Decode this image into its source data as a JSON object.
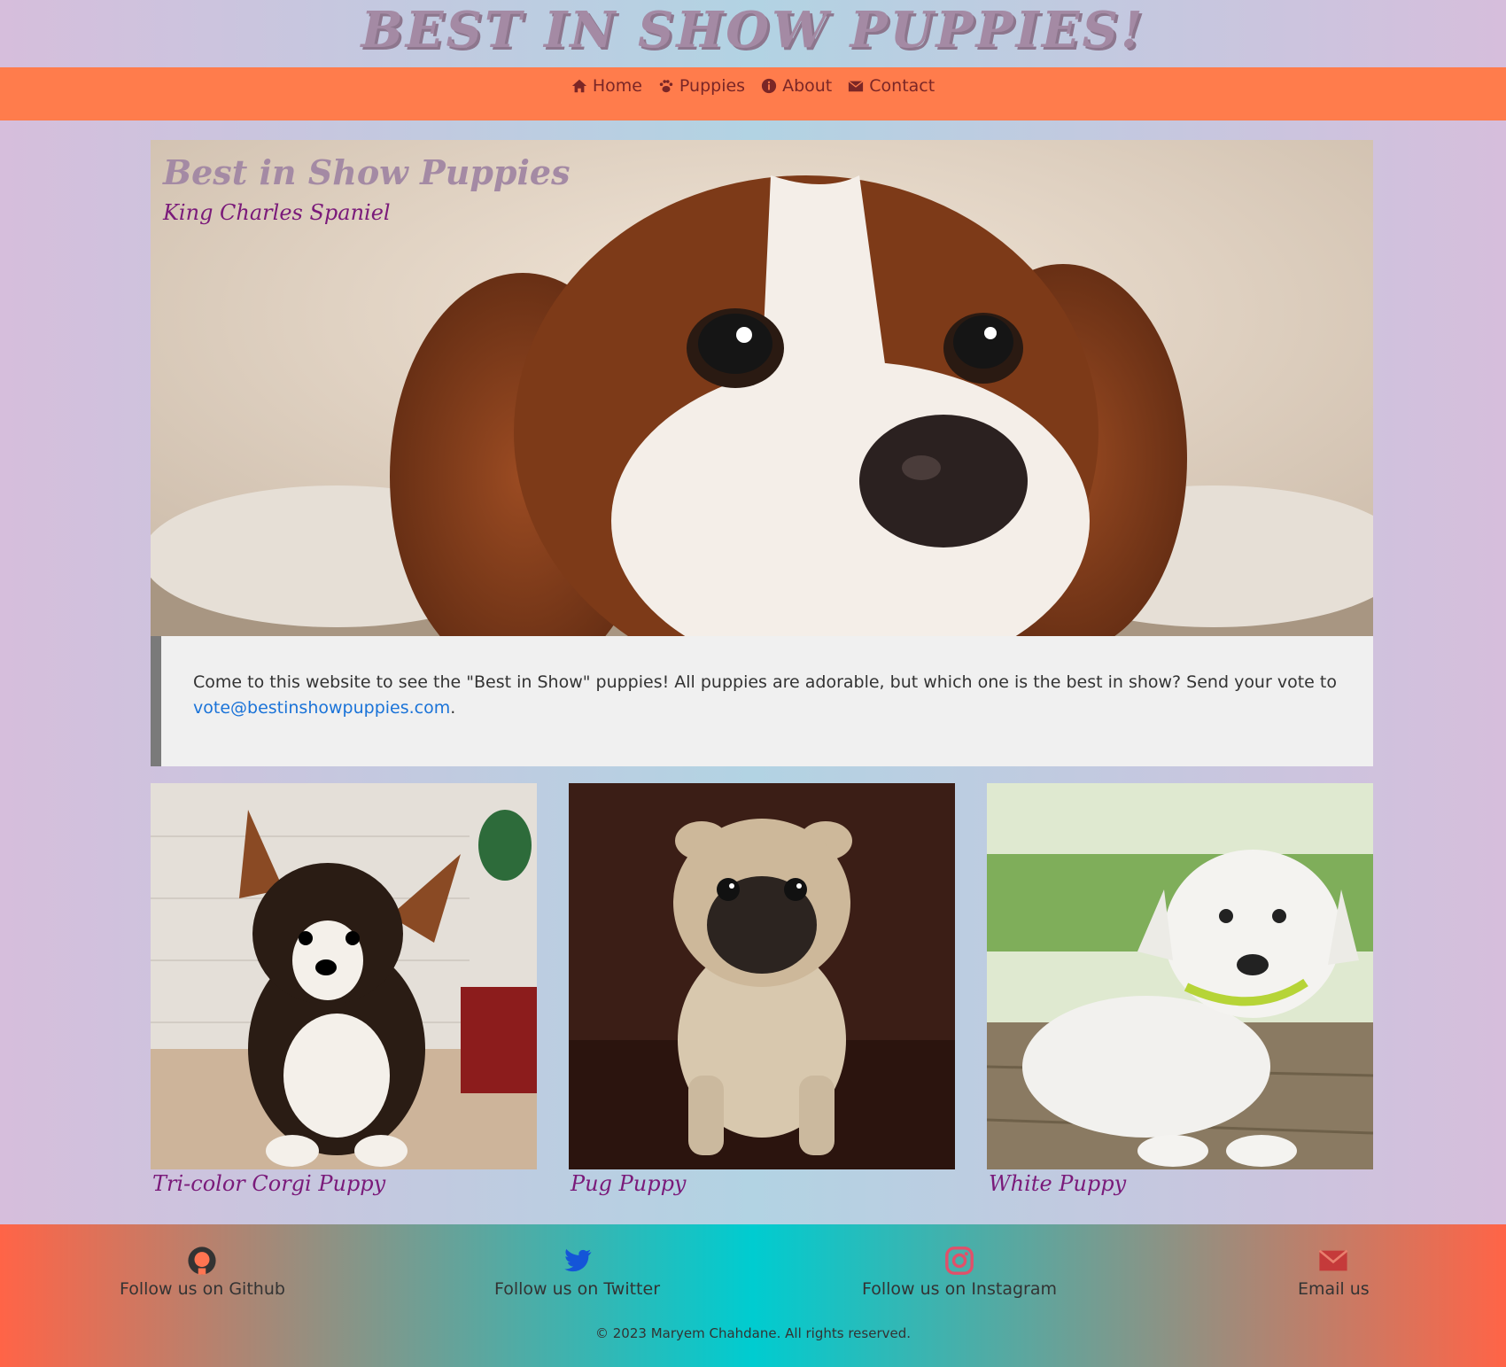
{
  "header": {
    "title": "BEST IN SHOW PUPPIES!"
  },
  "nav": {
    "items": [
      {
        "label": "Home",
        "icon": "home-icon"
      },
      {
        "label": "Puppies",
        "icon": "paw-icon"
      },
      {
        "label": "About",
        "icon": "info-icon"
      },
      {
        "label": "Contact",
        "icon": "envelope-icon"
      }
    ]
  },
  "hero": {
    "title": "Best in Show Puppies",
    "subtitle": "King Charles Spaniel"
  },
  "intro": {
    "text": "Come to this website to see the \"Best in Show\" puppies! All puppies are adorable, but which one is the best in show? Send your vote to ",
    "email": "vote@bestinshowpuppies.com",
    "end": "."
  },
  "puppies": [
    {
      "caption": "Tri-color Corgi Puppy"
    },
    {
      "caption": "Pug Puppy"
    },
    {
      "caption": "White Puppy"
    }
  ],
  "footer": {
    "links": [
      {
        "label": "Follow us on Github",
        "icon": "github-icon"
      },
      {
        "label": "Follow us on Twitter",
        "icon": "twitter-icon"
      },
      {
        "label": "Follow us on Instagram",
        "icon": "instagram-icon"
      },
      {
        "label": "Email us",
        "icon": "envelope-icon"
      }
    ],
    "copyright": "© 2023 Maryem Chahdane. All rights reserved."
  },
  "colors": {
    "nav_bg": "#ff7c4c",
    "title": "#a48aa4",
    "caption": "#7a1a7a",
    "link": "#1a73d8"
  }
}
